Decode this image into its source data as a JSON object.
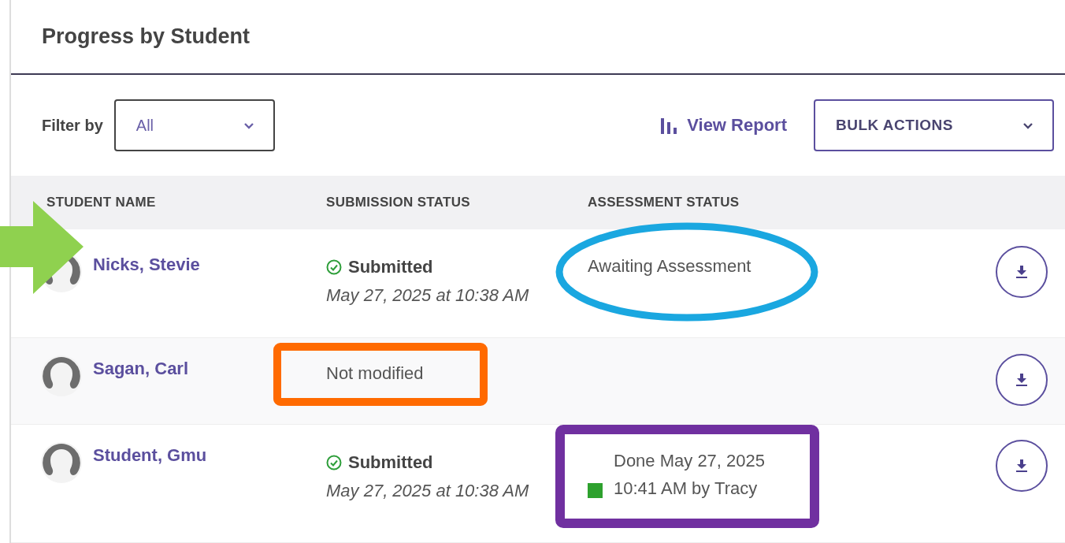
{
  "title": "Progress by Student",
  "filter": {
    "label": "Filter by",
    "value": "All"
  },
  "view_report": "View Report",
  "bulk_actions": "BULK ACTIONS",
  "table": {
    "columns": [
      "STUDENT NAME",
      "SUBMISSION STATUS",
      "ASSESSMENT STATUS"
    ],
    "rows": [
      {
        "name": "Nicks, Stevie",
        "submission": {
          "kind": "submitted",
          "label": "Submitted",
          "date": "May 27, 2025 at 10:38 AM"
        },
        "assessment": {
          "kind": "awaiting",
          "text": "Awaiting Assessment"
        }
      },
      {
        "name": "Sagan, Carl",
        "submission": {
          "kind": "plain",
          "label": "Not modified"
        },
        "assessment": {
          "kind": "none"
        }
      },
      {
        "name": "Student, Gmu",
        "submission": {
          "kind": "submitted",
          "label": "Submitted",
          "date": "May 27, 2025 at 10:38 AM"
        },
        "assessment": {
          "kind": "done",
          "text": "Done May 27, 2025 10:41 AM by Tracy",
          "color": "#2ea12e"
        }
      }
    ]
  }
}
